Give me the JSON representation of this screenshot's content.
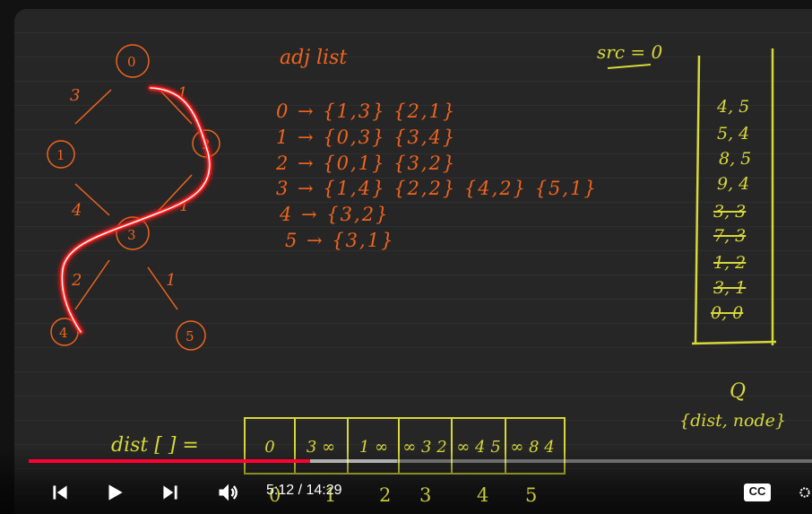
{
  "video": {
    "current_time": "5:12",
    "separator": " / ",
    "duration": "14:29",
    "progress_fraction": 0.359,
    "buffered_fraction": 0.47,
    "cc_label": "CC"
  },
  "controls": {
    "previous_icon": "skip-previous-icon",
    "play_icon": "play-icon",
    "next_icon": "skip-next-icon",
    "volume_icon": "volume-icon",
    "cc_icon": "closed-captions-icon",
    "settings_icon": "settings-icon"
  },
  "whiteboard": {
    "graph_nodes": [
      "0",
      "1",
      "2",
      "3",
      "4",
      "5"
    ],
    "edge_weights": [
      "3",
      "1",
      "4",
      "1",
      "2",
      "1"
    ],
    "adj_title": "adj list",
    "adj_lines": [
      "0 → {1,3} {2,1}",
      "1 → {0,3} {3,4}",
      "2 → {0,1} {3,2}",
      "3 → {1,4} {2,2} {4,2} {5,1}",
      "4 → {3,2}",
      "5 → {3,1}"
    ],
    "src_label": "src = 0",
    "pq_items": [
      "4, 5",
      "5, 4",
      "8, 5",
      "9, 4",
      "3, 3",
      "7, 3",
      "1, 2",
      "3, 1",
      "0, 0"
    ],
    "pq_struck": [
      false,
      false,
      false,
      false,
      true,
      true,
      true,
      true,
      true
    ],
    "pq_label": "Q",
    "pq_caption": "{dist, node}",
    "dist_label": "dist [ ]  =",
    "dist_cells": [
      "0",
      "3 ∞",
      "1 ∞",
      "∞ 3 2",
      "∞ 4 5",
      "∞ 8 4"
    ],
    "dist_indices": [
      "0",
      "1",
      "2",
      "3",
      "4",
      "5"
    ]
  },
  "colors": {
    "marker_orange": "#f0641e",
    "marker_yellow": "#d7d83a",
    "highlight_red": "#ff1a1a",
    "progress_red": "#ff0033"
  }
}
